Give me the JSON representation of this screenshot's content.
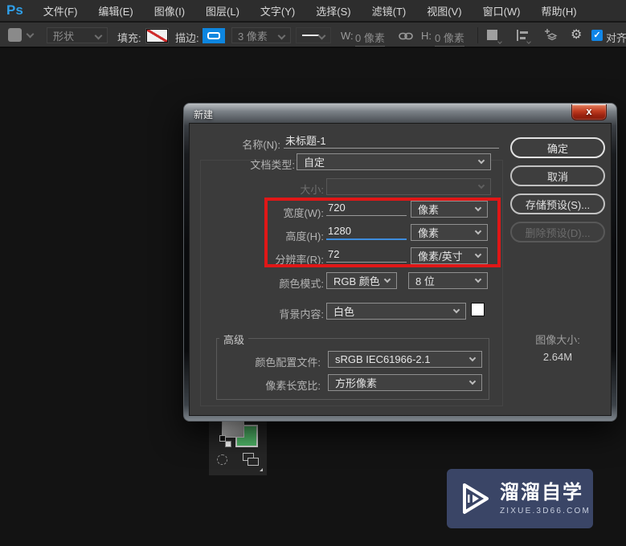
{
  "menu_bar": {
    "logo": "Ps",
    "items": [
      "文件(F)",
      "编辑(E)",
      "图像(I)",
      "图层(L)",
      "文字(Y)",
      "选择(S)",
      "滤镜(T)",
      "视图(V)",
      "窗口(W)",
      "帮助(H)"
    ]
  },
  "options_bar": {
    "tool_mode": "形状",
    "fill_label": "填充:",
    "stroke_label": "描边:",
    "stroke_width": "3 像素",
    "w_label": "W:",
    "w_value": "0 像素",
    "h_label": "H:",
    "h_value": "0 像素",
    "align_edges": "对齐边缘"
  },
  "icons": {
    "close": "x",
    "gear": "⚙",
    "check": "✓"
  },
  "dialog": {
    "title": "新建",
    "name_label": "名称(N):",
    "name_value": "未标题-1",
    "doc_type_label": "文档类型:",
    "doc_type_value": "自定",
    "size_label": "大小:",
    "width_label": "宽度(W):",
    "width_value": "720",
    "width_unit": "像素",
    "height_label": "高度(H):",
    "height_value": "1280",
    "height_unit": "像素",
    "resolution_label": "分辨率(R):",
    "resolution_value": "72",
    "resolution_unit": "像素/英寸",
    "color_mode_label": "颜色模式:",
    "color_mode_value": "RGB 颜色",
    "bit_depth_value": "8 位",
    "background_label": "背景内容:",
    "background_value": "白色",
    "advanced_label": "高级",
    "profile_label": "颜色配置文件:",
    "profile_value": "sRGB IEC61966-2.1",
    "aspect_label": "像素长宽比:",
    "aspect_value": "方形像素",
    "ok_button": "确定",
    "cancel_button": "取消",
    "save_preset_button": "存储预设(S)...",
    "delete_preset_button": "删除预设(D)...",
    "image_size_label": "图像大小:",
    "image_size_value": "2.64M",
    "highlight_color": "#e01717"
  },
  "toolbox": {
    "background_swatch_color": "#53bd6c"
  },
  "watermark": {
    "title": "溜溜自学",
    "url": "zixue.3d66.com",
    "bg_color": "#3a4566"
  }
}
